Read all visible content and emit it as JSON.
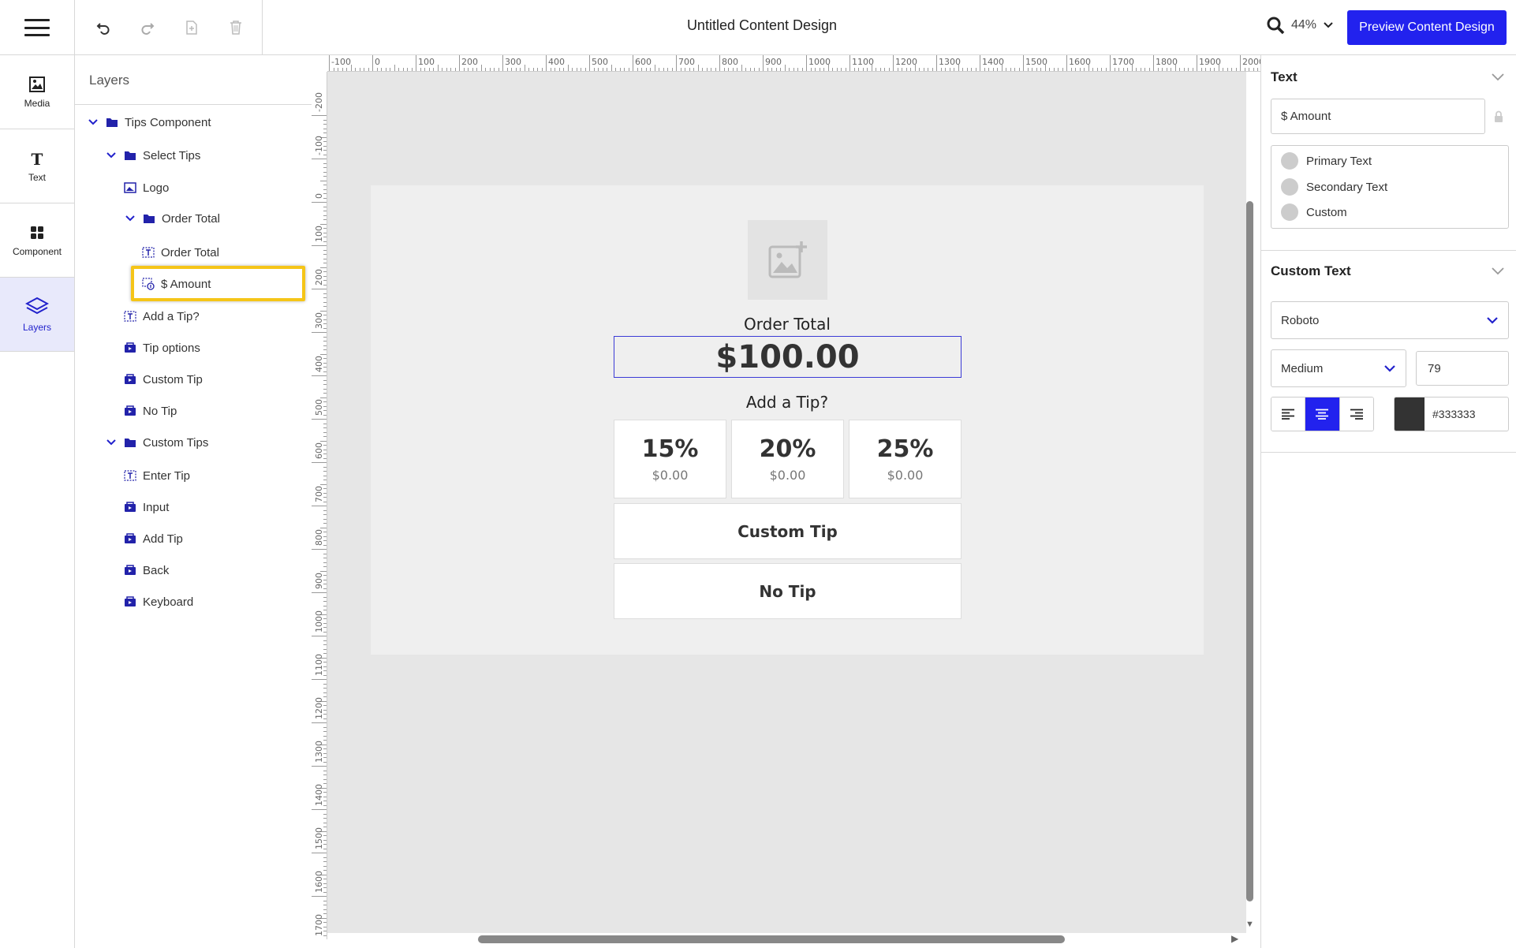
{
  "header": {
    "title": "Untitled Content Design",
    "zoom": "44%",
    "preview_label": "Preview Content Design"
  },
  "rail": [
    {
      "label": "Media",
      "icon": "image-icon"
    },
    {
      "label": "Text",
      "icon": "text-icon"
    },
    {
      "label": "Component",
      "icon": "grid-icon"
    },
    {
      "label": "Layers",
      "icon": "layers-icon"
    }
  ],
  "layers": {
    "title": "Layers",
    "items": [
      {
        "label": "Tips Component",
        "type": "folder"
      },
      {
        "label": "Select Tips",
        "type": "folder"
      },
      {
        "label": "Logo",
        "type": "image"
      },
      {
        "label": "Order Total",
        "type": "folder"
      },
      {
        "label": "Order Total",
        "type": "text"
      },
      {
        "label": "$ Amount",
        "type": "dynamic-text"
      },
      {
        "label": "Add a Tip?",
        "type": "text"
      },
      {
        "label": "Tip options",
        "type": "component"
      },
      {
        "label": "Custom Tip",
        "type": "component"
      },
      {
        "label": "No Tip",
        "type": "component"
      },
      {
        "label": "Custom Tips",
        "type": "folder"
      },
      {
        "label": "Enter Tip",
        "type": "text"
      },
      {
        "label": "Input",
        "type": "component"
      },
      {
        "label": "Add Tip",
        "type": "component"
      },
      {
        "label": "Back",
        "type": "component"
      },
      {
        "label": "Keyboard",
        "type": "component"
      }
    ],
    "selected": "$ Amount"
  },
  "rulers": {
    "top": [
      "-100",
      "0",
      "100",
      "200",
      "300",
      "400",
      "500",
      "600",
      "700",
      "800",
      "900",
      "1000",
      "1100",
      "1200",
      "1300",
      "1400",
      "1500",
      "1600",
      "1700",
      "1800",
      "1900",
      "2000"
    ],
    "left": [
      "-200",
      "-100",
      "0",
      "100",
      "200",
      "300",
      "400",
      "500",
      "600",
      "700",
      "800",
      "900",
      "1000",
      "1100",
      "1200",
      "1300",
      "1400",
      "1500",
      "1600",
      "1700"
    ]
  },
  "canvas": {
    "order_total_label": "Order Total",
    "amount": "$100.00",
    "add_tip_label": "Add a Tip?",
    "tips": [
      {
        "pct": "15%",
        "amount": "$0.00"
      },
      {
        "pct": "20%",
        "amount": "$0.00"
      },
      {
        "pct": "25%",
        "amount": "$0.00"
      }
    ],
    "custom_tip": "Custom Tip",
    "no_tip": "No Tip"
  },
  "props": {
    "text_section": "Text",
    "text_value": "$ Amount",
    "text_styles": [
      "Primary Text",
      "Secondary Text",
      "Custom"
    ],
    "custom_text_section": "Custom Text",
    "font_family": "Roboto",
    "font_weight": "Medium",
    "font_size": "79",
    "color_hex": "#333333",
    "alignment": "center"
  },
  "colors": {
    "accent": "#2222ee",
    "highlight": "#f5c518",
    "text_color": "#333333"
  }
}
